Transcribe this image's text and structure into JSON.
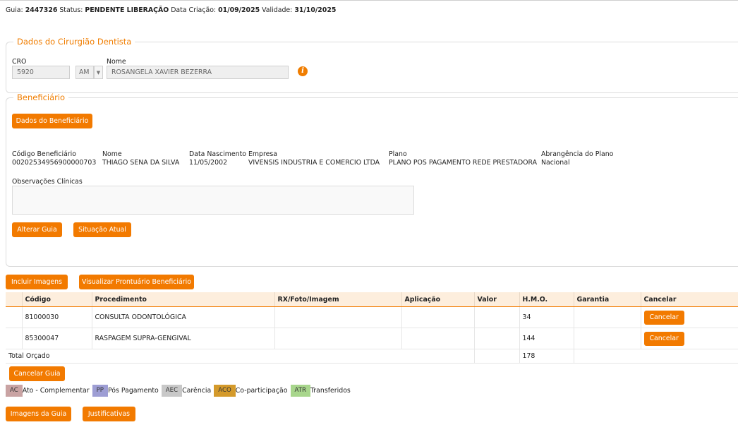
{
  "header": {
    "guia_label": "Guia:",
    "guia_value": "2447326",
    "status_label": "Status:",
    "status_value": "PENDENTE LIBERAÇÃO",
    "criacao_label": "Data Criação:",
    "criacao_value": "01/09/2025",
    "validade_label": "Validade:",
    "validade_value": "31/10/2025"
  },
  "dentista": {
    "legend": "Dados do Cirurgião Dentista",
    "cro_label": "CRO",
    "cro_value": "5920",
    "uf_value": "AM",
    "nome_label": "Nome",
    "nome_value": "ROSANGELA XAVIER BEZERRA",
    "info_icon": "info-icon"
  },
  "beneficiario": {
    "legend": "Beneficiário",
    "dados_button": "Dados do Beneficiário",
    "fields": [
      {
        "label": "Código Beneficiário",
        "value": "00202534956900000703"
      },
      {
        "label": "Nome",
        "value": "THIAGO SENA DA SILVA"
      },
      {
        "label": "Data Nascimento",
        "value": "11/05/2002"
      },
      {
        "label": "Empresa",
        "value": "VIVENSIS INDUSTRIA E COMERCIO LTDA"
      },
      {
        "label": "Plano",
        "value": "PLANO POS PAGAMENTO REDE PRESTADORA"
      },
      {
        "label": "Abrangência do Plano",
        "value": "Nacional"
      }
    ],
    "obs_label": "Observações Clínicas",
    "obs_value": "",
    "alterar_button": "Alterar Guia",
    "situacao_button": "Situação Atual"
  },
  "actions": {
    "incluir_imagens": "Incluir Imagens",
    "visualizar_prontuario": "Visualizar Prontuário Beneficiário"
  },
  "table": {
    "headers": [
      "",
      "Código",
      "Procedimento",
      "RX/Foto/Imagem",
      "Aplicação",
      "Valor",
      "H.M.O.",
      "Garantia",
      "Cancelar"
    ],
    "rows": [
      {
        "codigo": "81000030",
        "procedimento": "CONSULTA ODONTOLÓGICA",
        "rx": "",
        "aplicacao": "",
        "valor": "",
        "hmo": "34",
        "garantia": "",
        "cancelar": "Cancelar"
      },
      {
        "codigo": "85300047",
        "procedimento": "RASPAGEM SUPRA-GENGIVAL",
        "rx": "",
        "aplicacao": "",
        "valor": "",
        "hmo": "144",
        "garantia": "",
        "cancelar": "Cancelar"
      }
    ],
    "total_label": "Total Orçado",
    "total_hmo": "178"
  },
  "cancelar_guia": "Cancelar Guia",
  "legend": [
    {
      "code": "AC",
      "text": "Ato - Complementar",
      "color": "#c9a3a3"
    },
    {
      "code": "PP",
      "text": "Pós Pagamento",
      "color": "#9e9ed4"
    },
    {
      "code": "AEC",
      "text": "Carência",
      "color": "#c8c8c8"
    },
    {
      "code": "ACO",
      "text": "Co-participação",
      "color": "#d49a2b"
    },
    {
      "code": "ATR",
      "text": "Transferidos",
      "color": "#a8d68c"
    }
  ],
  "footer": {
    "imagens_guia": "Imagens da Guia",
    "justificativas": "Justificativas"
  },
  "colors": {
    "accent": "#f27a00",
    "legend_title": "#f07d00",
    "table_header_bg": "#fdeedd"
  }
}
